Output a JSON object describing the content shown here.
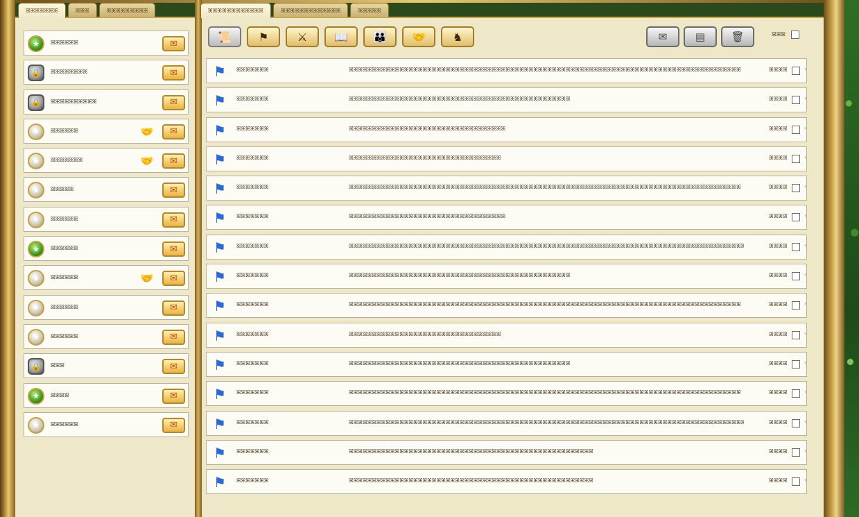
{
  "left_tabs": [
    "ꕤꕤꕤꕤꕤꕤꕤ",
    "ꕤꕤꕤ",
    "ꕤꕤꕤꕤꕤꕤꕤꕤꕤ"
  ],
  "right_tabs": [
    "ꕤꕤꕤꕤꕤꕤꕤꕤꕤꕤꕤꕤ",
    "ꕤꕤꕤꕤꕤꕤꕤꕤꕤꕤꕤꕤꕤ",
    "ꕤꕤꕤꕤꕤ"
  ],
  "contacts": [
    {
      "name": "ꕤꕤꕤꕤꕤꕤ",
      "status": "green",
      "hand": false
    },
    {
      "name": "ꕤꕤꕤꕤꕤꕤꕤꕤ",
      "status": "lock",
      "hand": false
    },
    {
      "name": "ꕤꕤꕤꕤꕤꕤꕤꕤꕤꕤ",
      "status": "lock",
      "hand": false
    },
    {
      "name": "ꕤꕤꕤꕤꕤꕤ",
      "status": "gray",
      "hand": true
    },
    {
      "name": "ꕤꕤꕤꕤꕤꕤꕤ",
      "status": "gray",
      "hand": true
    },
    {
      "name": "ꕤꕤꕤꕤꕤ",
      "status": "gray",
      "hand": false
    },
    {
      "name": "ꕤꕤꕤꕤꕤꕤ",
      "status": "gray",
      "hand": false
    },
    {
      "name": "ꕤꕤꕤꕤꕤꕤ",
      "status": "green",
      "hand": false
    },
    {
      "name": "ꕤꕤꕤꕤꕤꕤ",
      "status": "gray",
      "hand": true
    },
    {
      "name": "ꕤꕤꕤꕤꕤꕤ",
      "status": "gray",
      "hand": false
    },
    {
      "name": "ꕤꕤꕤꕤꕤꕤ",
      "status": "gray",
      "hand": false
    },
    {
      "name": "ꕤꕤꕤ",
      "status": "lock",
      "hand": false
    },
    {
      "name": "ꕤꕤꕤꕤ",
      "status": "green",
      "hand": false
    },
    {
      "name": "ꕤꕤꕤꕤꕤꕤ",
      "status": "gray",
      "hand": false
    }
  ],
  "toolbar_icons": [
    "scroll-icon",
    "flag-icon",
    "sword-icon",
    "book-icon",
    "family-icon",
    "handshake-icon",
    "knight-icon"
  ],
  "toolbar2_icons": [
    "mail-icon",
    "inbox-icon",
    "trash-icon"
  ],
  "select_all_label": "ꕤꕤꕤ",
  "messages": [
    {
      "sender": "ꕤꕤꕤꕤꕤꕤꕤ",
      "subject": "ꕤꕤꕤꕤꕤꕤꕤꕤꕤꕤꕤꕤꕤꕤꕤꕤꕤꕤꕤꕤꕤꕤꕤꕤꕤꕤꕤꕤꕤꕤꕤꕤꕤꕤꕤꕤꕤꕤꕤꕤꕤꕤꕤꕤꕤꕤꕤꕤꕤꕤꕤꕤꕤꕤꕤꕤꕤꕤꕤꕤꕤꕤꕤꕤꕤꕤꕤꕤꕤꕤꕤꕤꕤꕤꕤꕤꕤꕤꕤꕤꕤꕤꕤꕤꕤ",
      "delete": "ꕤꕤꕤꕤ"
    },
    {
      "sender": "ꕤꕤꕤꕤꕤꕤꕤ",
      "subject": "ꕤꕤꕤꕤꕤꕤꕤꕤꕤꕤꕤꕤꕤꕤꕤꕤꕤꕤꕤꕤꕤꕤꕤꕤꕤꕤꕤꕤꕤꕤꕤꕤꕤꕤꕤꕤꕤꕤꕤꕤꕤꕤꕤꕤꕤꕤꕤꕤ",
      "delete": "ꕤꕤꕤꕤ"
    },
    {
      "sender": "ꕤꕤꕤꕤꕤꕤꕤ",
      "subject": "ꕤꕤꕤꕤꕤꕤꕤꕤꕤꕤꕤꕤꕤꕤꕤꕤꕤꕤꕤꕤꕤꕤꕤꕤꕤꕤꕤꕤꕤꕤꕤꕤꕤꕤ",
      "delete": "ꕤꕤꕤꕤ"
    },
    {
      "sender": "ꕤꕤꕤꕤꕤꕤꕤ",
      "subject": "ꕤꕤꕤꕤꕤꕤꕤꕤꕤꕤꕤꕤꕤꕤꕤꕤꕤꕤꕤꕤꕤꕤꕤꕤꕤꕤꕤꕤꕤꕤꕤꕤꕤ",
      "delete": "ꕤꕤꕤꕤ"
    },
    {
      "sender": "ꕤꕤꕤꕤꕤꕤꕤ",
      "subject": "ꕤꕤꕤꕤꕤꕤꕤꕤꕤꕤꕤꕤꕤꕤꕤꕤꕤꕤꕤꕤꕤꕤꕤꕤꕤꕤꕤꕤꕤꕤꕤꕤꕤꕤꕤꕤꕤꕤꕤꕤꕤꕤꕤꕤꕤꕤꕤꕤꕤꕤꕤꕤꕤꕤꕤꕤꕤꕤꕤꕤꕤꕤꕤꕤꕤꕤꕤꕤꕤꕤꕤꕤꕤꕤꕤꕤꕤꕤꕤꕤꕤꕤꕤꕤꕤ",
      "delete": "ꕤꕤꕤꕤ"
    },
    {
      "sender": "ꕤꕤꕤꕤꕤꕤꕤ",
      "subject": "ꕤꕤꕤꕤꕤꕤꕤꕤꕤꕤꕤꕤꕤꕤꕤꕤꕤꕤꕤꕤꕤꕤꕤꕤꕤꕤꕤꕤꕤꕤꕤꕤꕤꕤ",
      "delete": "ꕤꕤꕤꕤ"
    },
    {
      "sender": "ꕤꕤꕤꕤꕤꕤꕤ",
      "subject": "ꕤꕤꕤꕤꕤꕤꕤꕤꕤꕤꕤꕤꕤꕤꕤꕤꕤꕤꕤꕤꕤꕤꕤꕤꕤꕤꕤꕤꕤꕤꕤꕤꕤꕤꕤꕤꕤꕤꕤꕤꕤꕤꕤꕤꕤꕤꕤꕤꕤꕤꕤꕤꕤꕤꕤꕤꕤꕤꕤꕤꕤꕤꕤꕤꕤꕤꕤꕤꕤꕤꕤꕤꕤꕤꕤꕤꕤꕤꕤꕤꕤꕤꕤꕤꕤꕤ",
      "delete": "ꕤꕤꕤꕤ"
    },
    {
      "sender": "ꕤꕤꕤꕤꕤꕤꕤ",
      "subject": "ꕤꕤꕤꕤꕤꕤꕤꕤꕤꕤꕤꕤꕤꕤꕤꕤꕤꕤꕤꕤꕤꕤꕤꕤꕤꕤꕤꕤꕤꕤꕤꕤꕤꕤꕤꕤꕤꕤꕤꕤꕤꕤꕤꕤꕤꕤꕤꕤ",
      "delete": "ꕤꕤꕤꕤ"
    },
    {
      "sender": "ꕤꕤꕤꕤꕤꕤꕤ",
      "subject": "ꕤꕤꕤꕤꕤꕤꕤꕤꕤꕤꕤꕤꕤꕤꕤꕤꕤꕤꕤꕤꕤꕤꕤꕤꕤꕤꕤꕤꕤꕤꕤꕤꕤꕤꕤꕤꕤꕤꕤꕤꕤꕤꕤꕤꕤꕤꕤꕤꕤꕤꕤꕤꕤꕤꕤꕤꕤꕤꕤꕤꕤꕤꕤꕤꕤꕤꕤꕤꕤꕤꕤꕤꕤꕤꕤꕤꕤꕤꕤꕤꕤꕤꕤꕤꕤ",
      "delete": "ꕤꕤꕤꕤ"
    },
    {
      "sender": "ꕤꕤꕤꕤꕤꕤꕤ",
      "subject": "ꕤꕤꕤꕤꕤꕤꕤꕤꕤꕤꕤꕤꕤꕤꕤꕤꕤꕤꕤꕤꕤꕤꕤꕤꕤꕤꕤꕤꕤꕤꕤꕤꕤ",
      "delete": "ꕤꕤꕤꕤ"
    },
    {
      "sender": "ꕤꕤꕤꕤꕤꕤꕤ",
      "subject": "ꕤꕤꕤꕤꕤꕤꕤꕤꕤꕤꕤꕤꕤꕤꕤꕤꕤꕤꕤꕤꕤꕤꕤꕤꕤꕤꕤꕤꕤꕤꕤꕤꕤꕤꕤꕤꕤꕤꕤꕤꕤꕤꕤꕤꕤꕤꕤꕤ",
      "delete": "ꕤꕤꕤꕤ"
    },
    {
      "sender": "ꕤꕤꕤꕤꕤꕤꕤ",
      "subject": "ꕤꕤꕤꕤꕤꕤꕤꕤꕤꕤꕤꕤꕤꕤꕤꕤꕤꕤꕤꕤꕤꕤꕤꕤꕤꕤꕤꕤꕤꕤꕤꕤꕤꕤꕤꕤꕤꕤꕤꕤꕤꕤꕤꕤꕤꕤꕤꕤꕤꕤꕤꕤꕤꕤꕤꕤꕤꕤꕤꕤꕤꕤꕤꕤꕤꕤꕤꕤꕤꕤꕤꕤꕤꕤꕤꕤꕤꕤꕤꕤꕤꕤꕤꕤꕤ",
      "delete": "ꕤꕤꕤꕤ"
    },
    {
      "sender": "ꕤꕤꕤꕤꕤꕤꕤ",
      "subject": "ꕤꕤꕤꕤꕤꕤꕤꕤꕤꕤꕤꕤꕤꕤꕤꕤꕤꕤꕤꕤꕤꕤꕤꕤꕤꕤꕤꕤꕤꕤꕤꕤꕤꕤꕤꕤꕤꕤꕤꕤꕤꕤꕤꕤꕤꕤꕤꕤꕤꕤꕤꕤꕤꕤꕤꕤꕤꕤꕤꕤꕤꕤꕤꕤꕤꕤꕤꕤꕤꕤꕤꕤꕤꕤꕤꕤꕤꕤꕤꕤꕤꕤꕤꕤꕤꕤ",
      "delete": "ꕤꕤꕤꕤ"
    },
    {
      "sender": "ꕤꕤꕤꕤꕤꕤꕤ",
      "subject": "ꕤꕤꕤꕤꕤꕤꕤꕤꕤꕤꕤꕤꕤꕤꕤꕤꕤꕤꕤꕤꕤꕤꕤꕤꕤꕤꕤꕤꕤꕤꕤꕤꕤꕤꕤꕤꕤꕤꕤꕤꕤꕤꕤꕤꕤꕤꕤꕤꕤꕤꕤꕤꕤ",
      "delete": "ꕤꕤꕤꕤ"
    },
    {
      "sender": "ꕤꕤꕤꕤꕤꕤꕤ",
      "subject": "ꕤꕤꕤꕤꕤꕤꕤꕤꕤꕤꕤꕤꕤꕤꕤꕤꕤꕤꕤꕤꕤꕤꕤꕤꕤꕤꕤꕤꕤꕤꕤꕤꕤꕤꕤꕤꕤꕤꕤꕤꕤꕤꕤꕤꕤꕤꕤꕤꕤꕤꕤꕤꕤ",
      "delete": "ꕤꕤꕤꕤ"
    }
  ]
}
